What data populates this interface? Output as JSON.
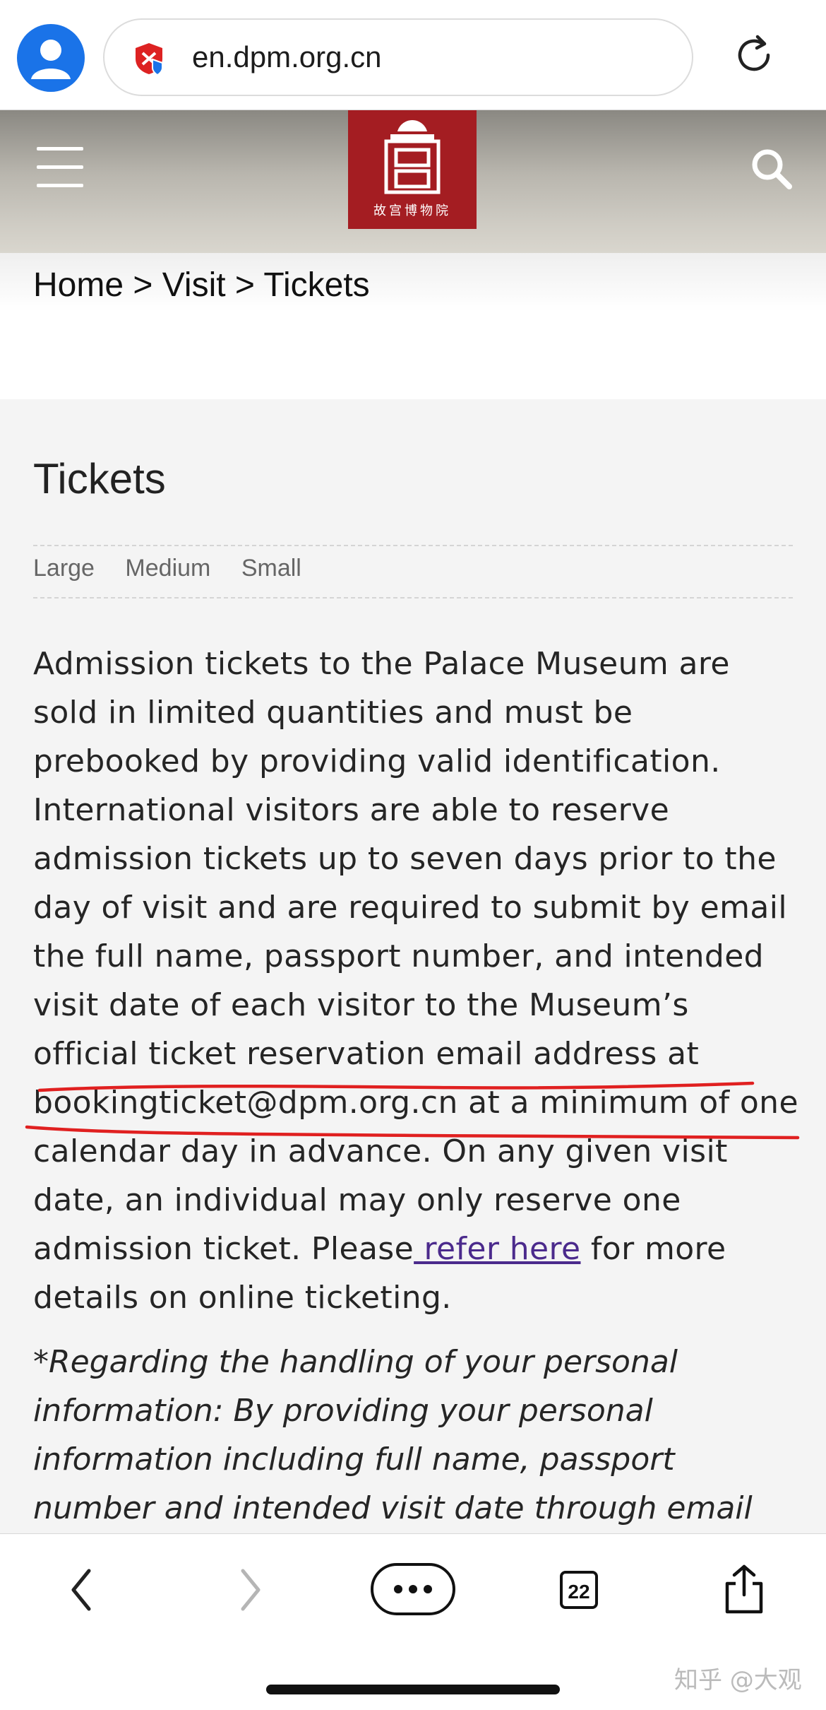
{
  "browser": {
    "url": "en.dpm.org.cn",
    "icons": [
      "user-avatar-icon",
      "site-shield-icon",
      "reload-icon"
    ]
  },
  "header": {
    "logo_text": "故宫博物院",
    "icons": [
      "menu-icon",
      "search-icon"
    ]
  },
  "breadcrumb": {
    "items": [
      "Home",
      "Visit",
      "Tickets"
    ],
    "separator": ">"
  },
  "main": {
    "title": "Tickets",
    "font_sizes": [
      "Large",
      "Medium",
      "Small"
    ],
    "paragraph": {
      "text": "Admission tickets to the Palace Museum are sold in limited quantities and must be prebooked by providing valid identification. International visitors are able to reserve admission tickets up to seven days prior to the day of visit and are required to submit by email the full name, passport number, and intended visit date of each visitor to the Museum’s official ticket reservation email address at bookingticket@dpm.org.cn at a minimum of one calendar day in advance. On any given visit date, an individual may only reserve one admission ticket. Please",
      "link": " refer here",
      "after_link": " for more details on online ticketing."
    },
    "note": "*Regarding the handling of your personal information: By providing your personal information including full name, passport number and intended visit date through email"
  },
  "toolbar": {
    "tabs_count": "22",
    "icons": [
      "back-icon",
      "forward-icon",
      "more-icon",
      "tabs-icon",
      "share-icon"
    ]
  },
  "watermark": "知乎 @大观",
  "colors": {
    "logo_red": "#a41d22",
    "link": "#4b2a8c",
    "annotation_red": "#e02020",
    "avatar_blue": "#1a73e8"
  }
}
